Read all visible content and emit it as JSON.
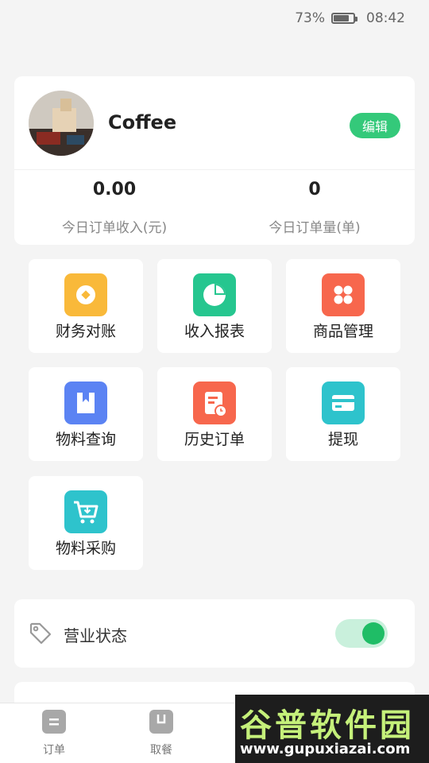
{
  "status_bar": {
    "battery": "73%",
    "time": "08:42"
  },
  "profile": {
    "name": "Coffee",
    "edit_label": "编辑",
    "stats": [
      {
        "value": "0.00",
        "label": "今日订单收入(元)"
      },
      {
        "value": "0",
        "label": "今日订单量(单)"
      }
    ]
  },
  "menu": [
    {
      "label": "财务对账",
      "icon": "coin-icon",
      "color": "#f9b93a"
    },
    {
      "label": "收入报表",
      "icon": "pie-chart-icon",
      "color": "#26c68f"
    },
    {
      "label": "商品管理",
      "icon": "grid-icon",
      "color": "#f7674d"
    },
    {
      "label": "物料查询",
      "icon": "bookmark-icon",
      "color": "#5b83f3"
    },
    {
      "label": "历史订单",
      "icon": "history-doc-icon",
      "color": "#f7674d"
    },
    {
      "label": "提现",
      "icon": "card-icon",
      "color": "#2ec3cc"
    },
    {
      "label": "物料采购",
      "icon": "cart-icon",
      "color": "#2ec3cc"
    }
  ],
  "business_status": {
    "label": "营业状态",
    "enabled": true
  },
  "tabs": [
    {
      "label": "订单",
      "icon": "orders-icon"
    },
    {
      "label": "取餐",
      "icon": "pickup-icon"
    }
  ],
  "watermark": {
    "title": "谷普软件园",
    "url": "www.gupuxiazai.com"
  },
  "colors": {
    "accent": "#34c97a",
    "toggle_on": "#1fbd66"
  }
}
